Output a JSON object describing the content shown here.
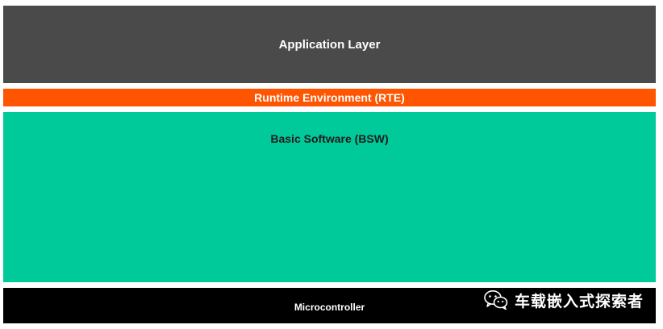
{
  "layers": {
    "application": {
      "label": "Application Layer",
      "color": "#4a4a4a"
    },
    "rte": {
      "label": "Runtime Environment (RTE)",
      "color": "#ff5400"
    },
    "bsw": {
      "label": "Basic Software (BSW)",
      "color": "#00c99a"
    },
    "microcontroller": {
      "label": "Microcontroller",
      "color": "#000000"
    }
  },
  "watermark": {
    "icon": "wechat-icon",
    "text": "车载嵌入式探索者"
  }
}
